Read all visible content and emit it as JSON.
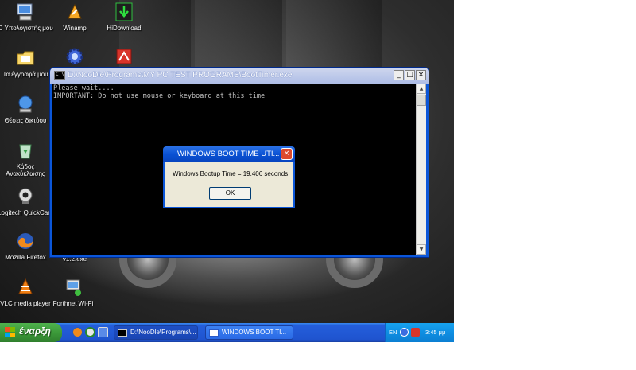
{
  "desktop": {
    "icons": [
      {
        "label": "Ο Υπολογιστής μου",
        "icon": "my-computer-icon"
      },
      {
        "label": "Winamp",
        "icon": "winamp-icon"
      },
      {
        "label": "HiDownload",
        "icon": "hidownload-icon"
      },
      {
        "label": "Τα έγγραφά μου",
        "icon": "my-documents-icon"
      },
      {
        "label": "Θέσεις δικτύου",
        "icon": "network-places-icon"
      },
      {
        "label": "Κάδος Ανακύκλωσης",
        "icon": "recycle-bin-icon"
      },
      {
        "label": "Logitech QuickCam",
        "icon": "webcam-icon"
      },
      {
        "label": "Mozilla Firefox",
        "icon": "firefox-icon"
      },
      {
        "label": "v1.2.exe",
        "icon": "exe-icon"
      },
      {
        "label": "VLC media player",
        "icon": "vlc-icon"
      },
      {
        "label": "Forthnet Wi-Fi",
        "icon": "wifi-icon"
      }
    ]
  },
  "console": {
    "title": "D:\\NooDle\\Programs\\MY PC TEST PROGRAMS\\BootTimer.exe",
    "icon_text": "C:\\",
    "lines": [
      "Please wait....",
      "IMPORTANT: Do not use mouse or keyboard at this time"
    ],
    "buttons": {
      "minimize": "_",
      "maximize": "□",
      "close": "×"
    }
  },
  "msgbox": {
    "title": "WINDOWS BOOT TIME UTI...",
    "message": "Windows Bootup Time =  19.406  seconds",
    "ok_label": "OK",
    "close_label": "×"
  },
  "taskbar": {
    "start_label": "έναρξη",
    "tasks": [
      {
        "label": "D:\\NooDle\\Programs\\..."
      },
      {
        "label": "WINDOWS BOOT TI..."
      }
    ],
    "tray": {
      "language": "EN",
      "time": "3:45 μμ"
    }
  },
  "colors": {
    "xp_blue": "#0b56d8",
    "start_green": "#3c9a3a",
    "tray_blue": "#0f8ee2",
    "close_red": "#dd4a2d"
  }
}
